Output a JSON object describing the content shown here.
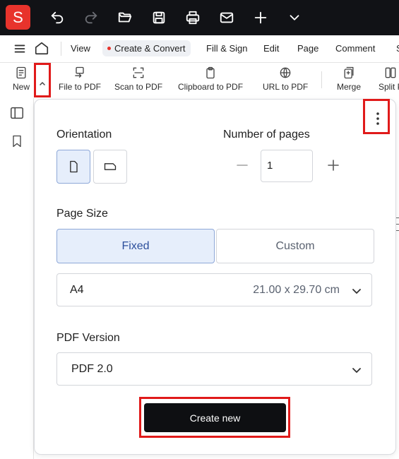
{
  "app": {
    "logo_letter": "S"
  },
  "topbar": {
    "icons": [
      "undo-icon",
      "redo-icon",
      "open-folder-icon",
      "save-icon",
      "print-icon",
      "mail-icon",
      "plus-icon",
      "chevron-down-icon"
    ]
  },
  "menu": {
    "items": [
      {
        "label": "View"
      },
      {
        "label": "Create & Convert",
        "active": true
      },
      {
        "label": "Fill & Sign"
      },
      {
        "label": "Edit"
      },
      {
        "label": "Page"
      },
      {
        "label": "Comment"
      },
      {
        "label": "S"
      }
    ]
  },
  "toolbar": {
    "new_label": "New",
    "tools": [
      {
        "label": "File to PDF"
      },
      {
        "label": "Scan to PDF"
      },
      {
        "label": "Clipboard to PDF"
      },
      {
        "label": "URL to PDF"
      },
      {
        "label": "Merge"
      },
      {
        "label": "Split P"
      }
    ]
  },
  "panel": {
    "orientation_label": "Orientation",
    "pages_label": "Number of pages",
    "pages_value": "1",
    "page_size_label": "Page Size",
    "size_fixed": "Fixed",
    "size_custom": "Custom",
    "paper_value": "A4",
    "paper_dims": "21.00 x 29.70 cm",
    "pdf_version_label": "PDF Version",
    "pdf_version_value": "PDF 2.0",
    "create_button": "Create new"
  },
  "colors": {
    "brand": "#e8332c",
    "highlight": "#e01a1a",
    "selected_bg": "#e6eefb",
    "primary_button": "#0e0f12"
  }
}
